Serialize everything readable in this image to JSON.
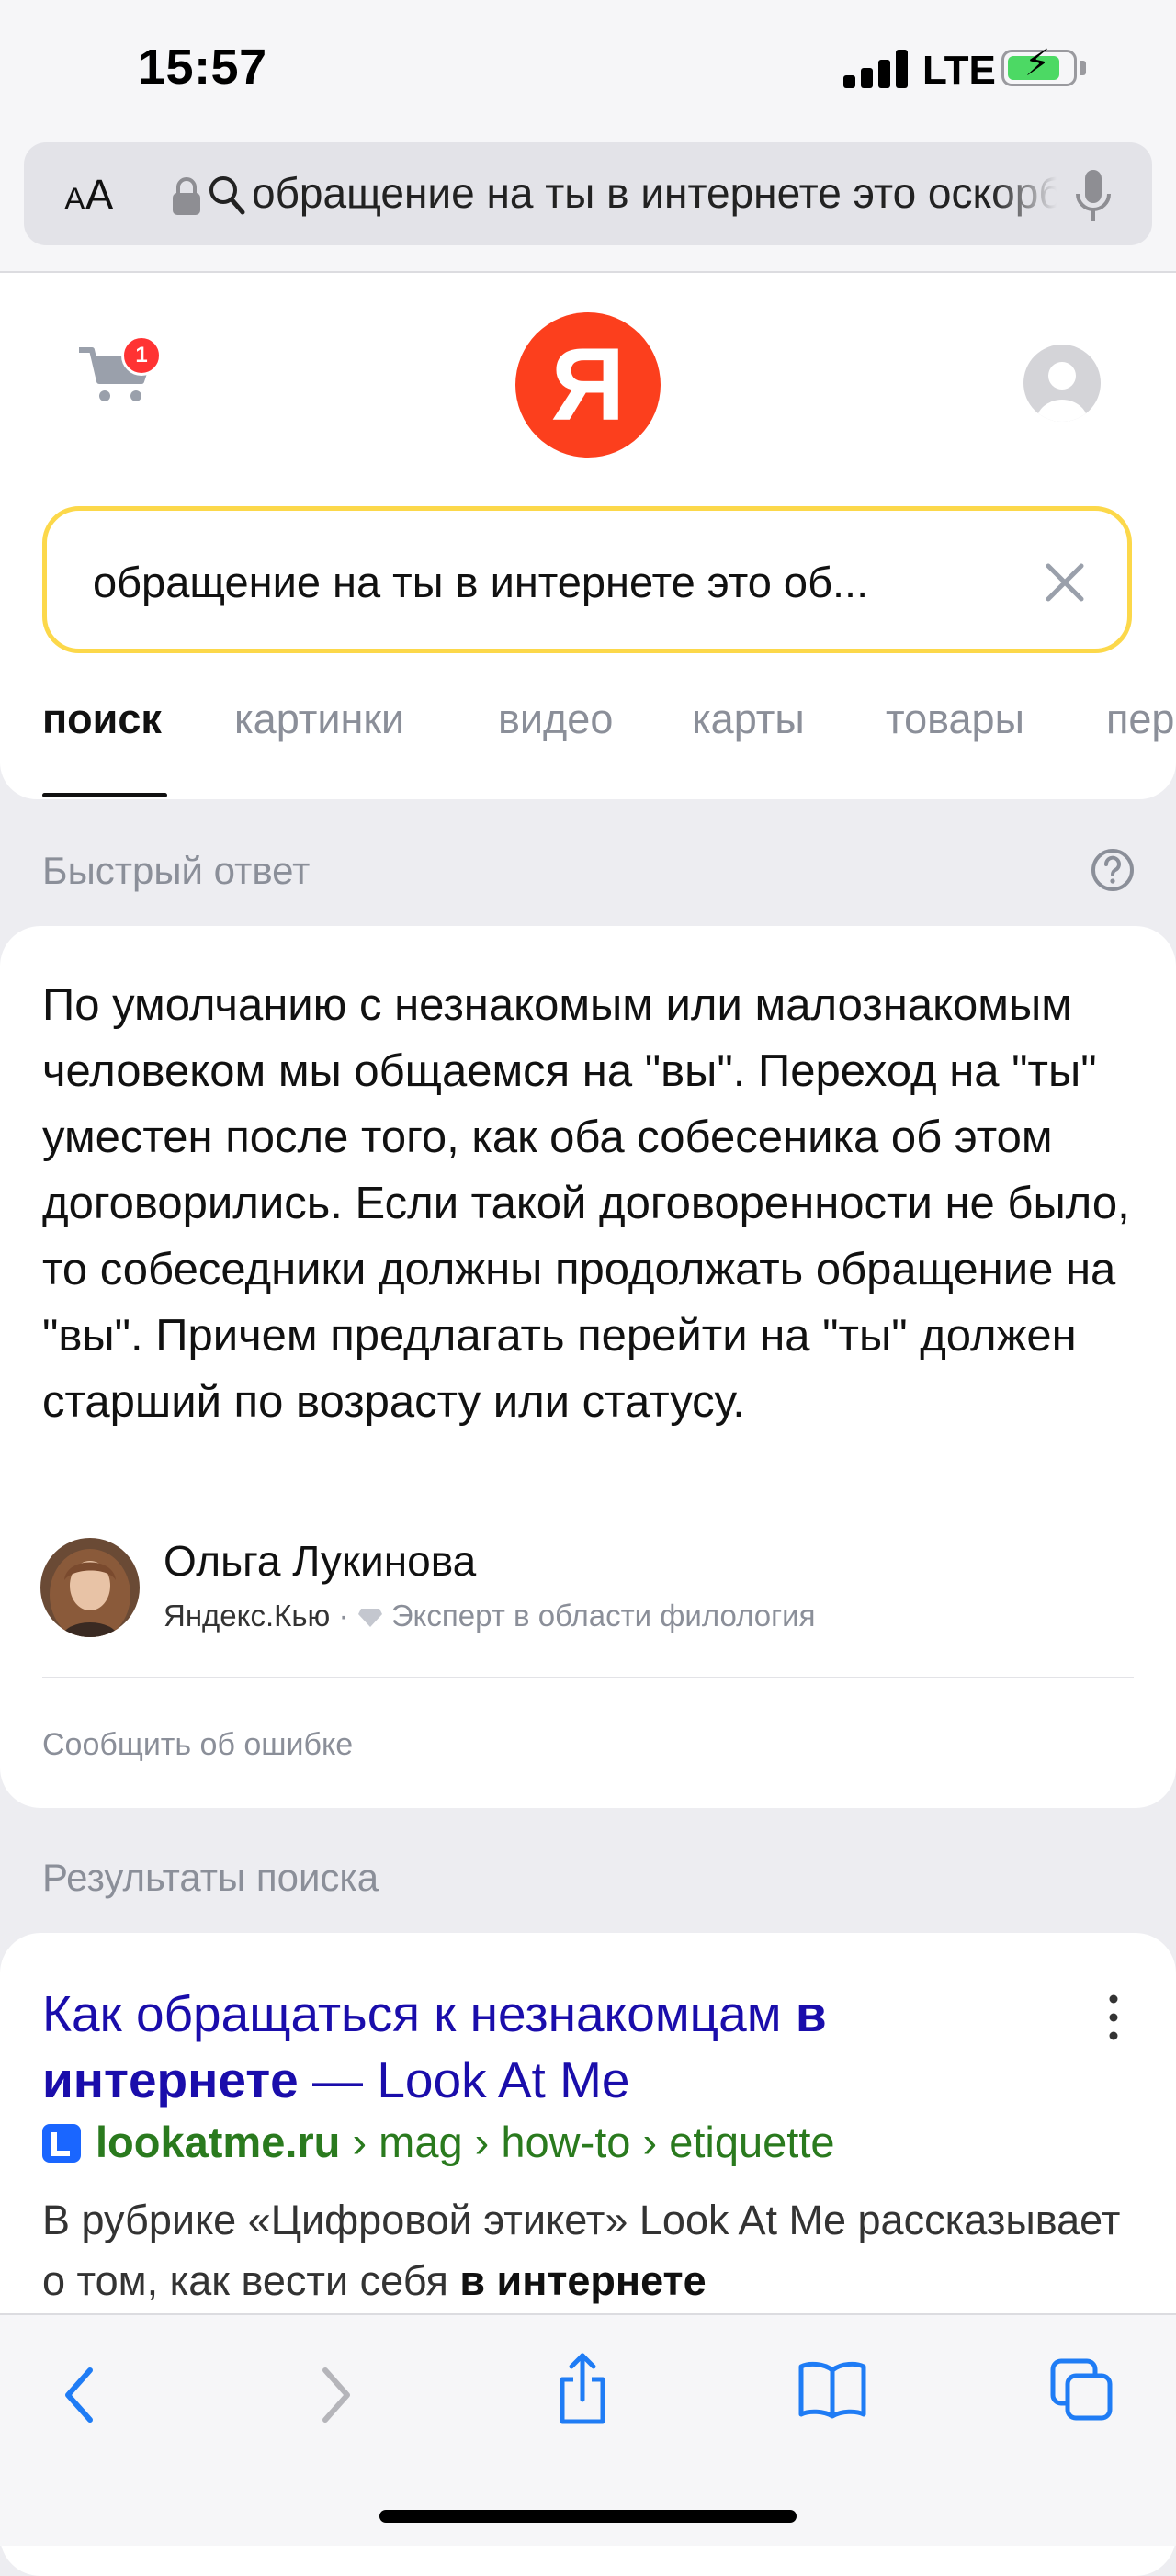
{
  "status_bar": {
    "time": "15:57",
    "network": "LTE"
  },
  "browser": {
    "text_size_button": {
      "small": "A",
      "large": "A"
    },
    "address_text": "обращение на ты в интернете это оскорбление"
  },
  "yandex": {
    "cart_badge": "1",
    "logo_letter": "Я",
    "search_query": "обращение на ты в интернете это об...",
    "tabs": [
      {
        "label": "поиск"
      },
      {
        "label": "картинки"
      },
      {
        "label": "видео"
      },
      {
        "label": "карты"
      },
      {
        "label": "товары"
      },
      {
        "label": "пер"
      }
    ]
  },
  "quick_answer": {
    "title": "Быстрый ответ",
    "text": "По умолчанию с незнакомым или малознакомым человеком мы общаемся на \"вы\". Переход на \"ты\" уместен после того, как оба собесеника об этом договорились. Если такой договоренности не было, то собеседники должны продолжать обращение на \"вы\". Причем предлагать перейти на \"ты\" должен старший по возрасту или статусу.",
    "author_name": "Ольга Лукинова",
    "source": "Яндекс.Кью",
    "separator": "·",
    "expertise": "Эксперт в области филология",
    "report_link": "Сообщить об ошибке"
  },
  "results": {
    "title": "Результаты поиска",
    "items": [
      {
        "title_part1": "Как обращаться к незнакомцам ",
        "title_bold1": "в",
        "title_bold2": "интернете",
        "title_part2": " — Look At Me",
        "domain": "lookatme.ru",
        "path": " › mag › how-to › etiquette",
        "snippet_part1": "В рубрике «Цифровой этикет» Look At Me рассказывает о том, как вести себя ",
        "snippet_bold": "в интернете"
      }
    ]
  },
  "colors": {
    "yandex_red": "#fc3f1d",
    "search_border": "#fcd84a",
    "link_title": "#1a0dab",
    "url_green": "#2a7a1e",
    "ios_blue": "#1f7cf5"
  }
}
